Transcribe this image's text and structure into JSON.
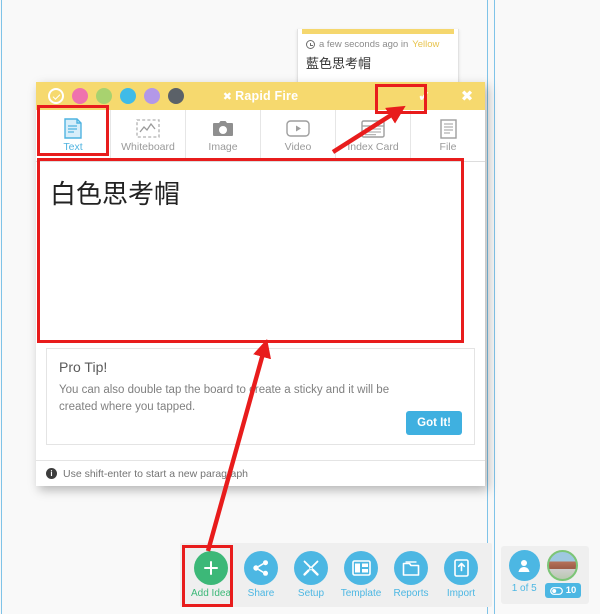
{
  "app": {
    "background_color": "#f8f8f8",
    "guide_color": "#7fc3e8",
    "accent_blue": "#4cb7e3",
    "accent_green": "#3cb878",
    "title_bar_color": "#f6d96e",
    "annotation_color": "#e81c1c"
  },
  "sticky_note": {
    "clock_icon": "clock-icon",
    "meta_prefix": "a few seconds ago in",
    "color_name": "Yellow",
    "text": "藍色思考帽"
  },
  "dialog": {
    "title": "Rapid Fire",
    "title_x_mark": "✖",
    "confirm_label": "✔",
    "close_label": "✖",
    "color_dots": [
      {
        "name": "color-dot-selected",
        "color": "transparent",
        "icon": "check-circle-icon"
      },
      {
        "name": "color-dot-pink",
        "color": "#ef72ad"
      },
      {
        "name": "color-dot-green",
        "color": "#a8d26f"
      },
      {
        "name": "color-dot-blue",
        "color": "#3fbbe8"
      },
      {
        "name": "color-dot-purple",
        "color": "#b398e8"
      },
      {
        "name": "color-dot-gray",
        "color": "#5b6168"
      }
    ],
    "tabs": [
      {
        "label": "Text",
        "icon": "text-document-icon",
        "active": true
      },
      {
        "label": "Whiteboard",
        "icon": "whiteboard-icon",
        "active": false
      },
      {
        "label": "Image",
        "icon": "camera-icon",
        "active": false
      },
      {
        "label": "Video",
        "icon": "play-icon",
        "active": false
      },
      {
        "label": "Index Card",
        "icon": "index-card-icon",
        "active": false
      },
      {
        "label": "File",
        "icon": "file-icon",
        "active": false
      }
    ],
    "text_value": "白色思考帽",
    "text_placeholder": "",
    "pro_tip": {
      "title": "Pro Tip!",
      "body": "You can also double tap the board to create a sticky and it will be created where you tapped.",
      "button_label": "Got It!"
    },
    "footer": {
      "info_icon": "info-icon",
      "hint": "Use shift-enter to start a new paragraph"
    }
  },
  "bottom_toolbar": {
    "items": [
      {
        "label": "Add Idea",
        "icon": "plus-icon",
        "color": "green"
      },
      {
        "label": "Share",
        "icon": "share-icon",
        "color": "blue"
      },
      {
        "label": "Setup",
        "icon": "tools-icon",
        "color": "blue"
      },
      {
        "label": "Template",
        "icon": "template-icon",
        "color": "blue"
      },
      {
        "label": "Reports",
        "icon": "reports-icon",
        "color": "blue"
      },
      {
        "label": "Import",
        "icon": "import-icon",
        "color": "blue"
      }
    ]
  },
  "status_widget": {
    "user_icon": "user-icon",
    "user_count": "1 of 5",
    "avatar_icon": "avatar-photo",
    "view_badge_icon": "eye-icon",
    "view_badge_count": "10"
  },
  "annotations": {
    "boxes": [
      "text-tab",
      "confirm-button",
      "text-area",
      "add-idea-button"
    ],
    "arrows": [
      "arrow-to-text-area",
      "arrow-to-confirm-button"
    ]
  }
}
